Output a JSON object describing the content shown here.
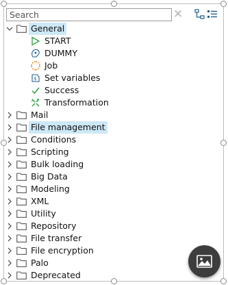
{
  "search": {
    "placeholder": "Search",
    "value": ""
  },
  "toolbar": {
    "clear_glyph": "✕"
  },
  "tree": {
    "general": {
      "label": "General",
      "expanded": true,
      "children": [
        {
          "label": "START",
          "icon": "start-triangle-icon"
        },
        {
          "label": "DUMMY",
          "icon": "dummy-icon"
        },
        {
          "label": "Job",
          "icon": "job-icon"
        },
        {
          "label": "Set variables",
          "icon": "set-variables-icon"
        },
        {
          "label": "Success",
          "icon": "success-check-icon"
        },
        {
          "label": "Transformation",
          "icon": "transformation-icon"
        }
      ]
    },
    "categories": [
      {
        "label": "Mail"
      },
      {
        "label": "File management"
      },
      {
        "label": "Conditions"
      },
      {
        "label": "Scripting"
      },
      {
        "label": "Bulk loading"
      },
      {
        "label": "Big Data"
      },
      {
        "label": "Modeling"
      },
      {
        "label": "XML"
      },
      {
        "label": "Utility"
      },
      {
        "label": "Repository"
      },
      {
        "label": "File transfer"
      },
      {
        "label": "File encryption"
      },
      {
        "label": "Palo"
      },
      {
        "label": "Deprecated"
      }
    ]
  },
  "colors": {
    "selection": "#cde8f6",
    "folder": "#555555",
    "start_green": "#2e9e3e",
    "fab_background": "#3d3d3d"
  }
}
